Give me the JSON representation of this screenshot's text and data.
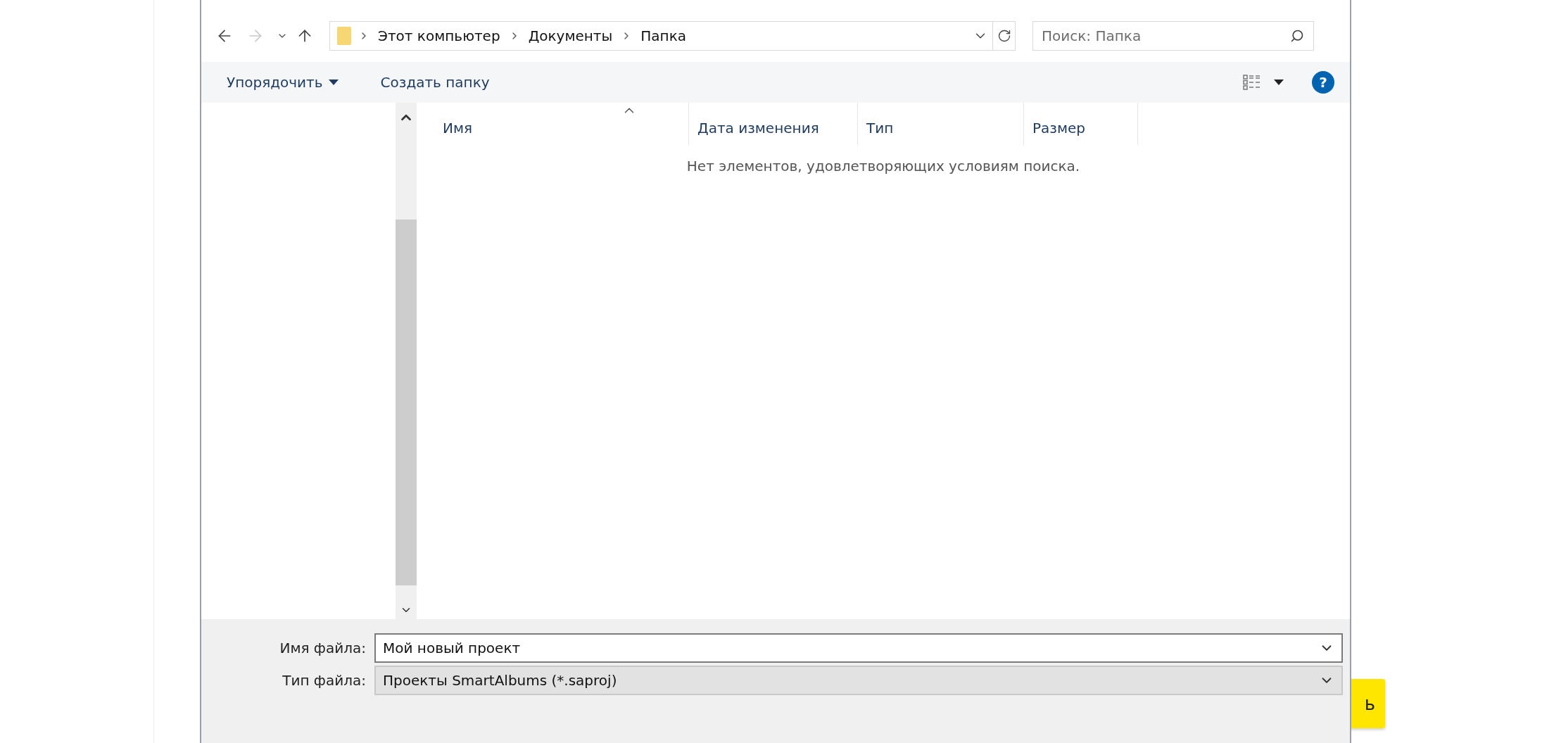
{
  "nav_buttons": [
    {
      "kind": "back",
      "disabled": false
    },
    {
      "kind": "forward",
      "disabled": true
    },
    {
      "kind": "recent",
      "disabled": false
    },
    {
      "kind": "up",
      "disabled": false
    }
  ],
  "address": {
    "crumbs": [
      "Этот компьютер",
      "Документы",
      "Папка"
    ]
  },
  "search": {
    "placeholder": "Поиск: Папка"
  },
  "toolbar": {
    "organize": "Упорядочить",
    "new_folder": "Создать папку",
    "help": "?"
  },
  "columns": [
    {
      "label": "Имя",
      "sorted": true
    },
    {
      "label": "Дата изменения",
      "sorted": false
    },
    {
      "label": "Тип",
      "sorted": false
    },
    {
      "label": "Размер",
      "sorted": false
    }
  ],
  "empty_message": "Нет элементов, удовлетворяющих условиям поиска.",
  "file_name": {
    "label": "Имя файла:",
    "value": "Мой новый проект"
  },
  "file_type": {
    "label": "Тип файла:",
    "value": "Проекты SmartAlbums (*.saproj)"
  },
  "background_button": {
    "label": "ь"
  }
}
